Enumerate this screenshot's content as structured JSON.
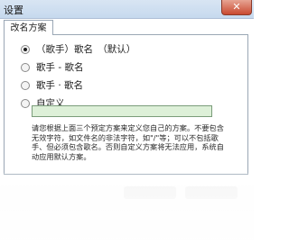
{
  "window": {
    "title": "设置",
    "close_glyph": "✕"
  },
  "tab": {
    "label": "改名方案"
  },
  "options": [
    {
      "label": "（歌手）歌名　（默认）",
      "checked": true
    },
    {
      "label": "歌手 - 歌名",
      "checked": false
    },
    {
      "label": "歌手 · 歌名",
      "checked": false
    },
    {
      "label": "自定义",
      "checked": false
    }
  ],
  "custom_field": {
    "value": ""
  },
  "description": "请您根据上面三个预定方案来定义您自己的方案。不要包含无效字符，如文件名的非法字符，如\"/\"等；可以不包括歌手、但必须包含歌名。否则自定义方案将无法应用，系统自动应用默认方案。",
  "colors": {
    "titlebar": "#c6d9ee",
    "close_button": "#c94a31",
    "input_background": "#ddf0d8"
  }
}
